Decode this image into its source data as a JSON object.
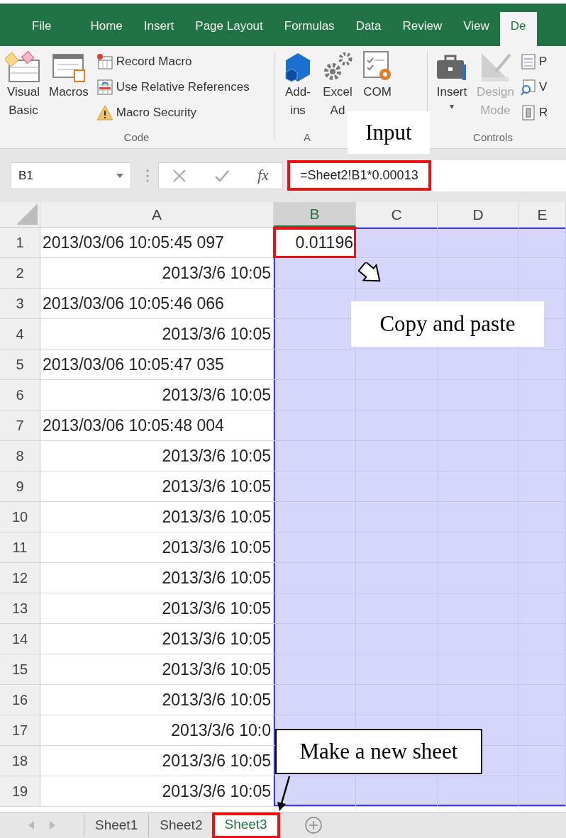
{
  "ribbon": {
    "tabs": [
      {
        "label": "File",
        "selected": false
      },
      {
        "label": "Home",
        "selected": false
      },
      {
        "label": "Insert",
        "selected": false
      },
      {
        "label": "Page Layout",
        "selected": false
      },
      {
        "label": "Formulas",
        "selected": false
      },
      {
        "label": "Data",
        "selected": false
      },
      {
        "label": "Review",
        "selected": false
      },
      {
        "label": "View",
        "selected": false
      },
      {
        "label": "De",
        "selected": true
      }
    ],
    "code_group": {
      "visual_basic": "Visual\nBasic",
      "macros": "Macros",
      "small_buttons": [
        "Record Macro",
        "Use Relative References",
        "Macro Security"
      ],
      "label": "Code"
    },
    "addins_group": {
      "add_ins": "Add-\nins",
      "excel_add_ins": "Excel\nAd",
      "com_add_ins": "COM",
      "label": "A"
    },
    "controls_group": {
      "insert": "Insert",
      "insert_caret": "▾",
      "design_mode": {
        "label": "Design\nMode",
        "disabled": true
      },
      "small_buttons": [
        "P",
        "V",
        "R"
      ],
      "label": "Controls"
    }
  },
  "formula_bar": {
    "name_box": "B1",
    "insert_function": "fx",
    "formula": "=Sheet2!B1*0.00013",
    "highlighted": true
  },
  "sheet": {
    "columns": [
      {
        "label": "A",
        "selected": false
      },
      {
        "label": "B",
        "selected": true
      },
      {
        "label": "C",
        "selected": false
      },
      {
        "label": "D",
        "selected": false
      },
      {
        "label": "E",
        "selected": false
      }
    ],
    "rows": [
      {
        "label": "1",
        "cells": [
          {
            "text": "2013/03/06 10:05:45 097",
            "kind": "text"
          },
          {
            "text": "0.01196",
            "kind": "number",
            "active": true,
            "highlighted": true,
            "in_range": true
          },
          {
            "in_range": true
          },
          {
            "in_range": true
          },
          {
            "in_range": true
          }
        ]
      },
      {
        "label": "2",
        "cells": [
          {
            "text": "2013/3/6 10:05",
            "kind": "date"
          },
          {
            "in_range": true
          },
          {
            "in_range": true
          },
          {
            "in_range": true
          },
          {
            "in_range": true
          }
        ]
      },
      {
        "label": "3",
        "cells": [
          {
            "text": "2013/03/06 10:05:46 066",
            "kind": "text"
          },
          {
            "in_range": true
          },
          {
            "in_range": true
          },
          {
            "in_range": true
          },
          {
            "in_range": true
          }
        ]
      },
      {
        "label": "4",
        "cells": [
          {
            "text": "2013/3/6 10:05",
            "kind": "date"
          },
          {
            "in_range": true
          },
          {
            "in_range": true
          },
          {
            "in_range": true
          },
          {
            "in_range": true
          }
        ]
      },
      {
        "label": "5",
        "cells": [
          {
            "text": "2013/03/06 10:05:47 035",
            "kind": "text"
          },
          {
            "in_range": true
          },
          {
            "in_range": true
          },
          {
            "in_range": true
          },
          {
            "in_range": true
          }
        ]
      },
      {
        "label": "6",
        "cells": [
          {
            "text": "2013/3/6 10:05",
            "kind": "date"
          },
          {
            "in_range": true
          },
          {
            "in_range": true
          },
          {
            "in_range": true
          },
          {
            "in_range": true
          }
        ]
      },
      {
        "label": "7",
        "cells": [
          {
            "text": "2013/03/06 10:05:48 004",
            "kind": "text"
          },
          {
            "in_range": true
          },
          {
            "in_range": true
          },
          {
            "in_range": true
          },
          {
            "in_range": true
          }
        ]
      },
      {
        "label": "8",
        "cells": [
          {
            "text": "2013/3/6 10:05",
            "kind": "date"
          },
          {
            "in_range": true
          },
          {
            "in_range": true
          },
          {
            "in_range": true
          },
          {
            "in_range": true
          }
        ]
      },
      {
        "label": "9",
        "cells": [
          {
            "text": "2013/3/6 10:05",
            "kind": "date"
          },
          {
            "in_range": true
          },
          {
            "in_range": true
          },
          {
            "in_range": true
          },
          {
            "in_range": true
          }
        ]
      },
      {
        "label": "10",
        "cells": [
          {
            "text": "2013/3/6 10:05",
            "kind": "date"
          },
          {
            "in_range": true
          },
          {
            "in_range": true
          },
          {
            "in_range": true
          },
          {
            "in_range": true
          }
        ]
      },
      {
        "label": "11",
        "cells": [
          {
            "text": "2013/3/6 10:05",
            "kind": "date"
          },
          {
            "in_range": true
          },
          {
            "in_range": true
          },
          {
            "in_range": true
          },
          {
            "in_range": true
          }
        ]
      },
      {
        "label": "12",
        "cells": [
          {
            "text": "2013/3/6 10:05",
            "kind": "date"
          },
          {
            "in_range": true
          },
          {
            "in_range": true
          },
          {
            "in_range": true
          },
          {
            "in_range": true
          }
        ]
      },
      {
        "label": "13",
        "cells": [
          {
            "text": "2013/3/6 10:05",
            "kind": "date"
          },
          {
            "in_range": true
          },
          {
            "in_range": true
          },
          {
            "in_range": true
          },
          {
            "in_range": true
          }
        ]
      },
      {
        "label": "14",
        "cells": [
          {
            "text": "2013/3/6 10:05",
            "kind": "date"
          },
          {
            "in_range": true
          },
          {
            "in_range": true
          },
          {
            "in_range": true
          },
          {
            "in_range": true
          }
        ]
      },
      {
        "label": "15",
        "cells": [
          {
            "text": "2013/3/6 10:05",
            "kind": "date"
          },
          {
            "in_range": true
          },
          {
            "in_range": true
          },
          {
            "in_range": true
          },
          {
            "in_range": true
          }
        ]
      },
      {
        "label": "16",
        "cells": [
          {
            "text": "2013/3/6 10:05",
            "kind": "date"
          },
          {
            "in_range": true
          },
          {
            "in_range": true
          },
          {
            "in_range": true
          },
          {
            "in_range": true
          }
        ]
      },
      {
        "label": "17",
        "cells": [
          {
            "text": "2013/3/6 10:0",
            "kind": "date"
          },
          {
            "in_range": true
          },
          {
            "in_range": true
          },
          {
            "in_range": true
          },
          {
            "in_range": true
          }
        ]
      },
      {
        "label": "18",
        "cells": [
          {
            "text": "2013/3/6 10:05",
            "kind": "date"
          },
          {
            "in_range": true
          },
          {
            "in_range": true
          },
          {
            "in_range": true
          },
          {
            "in_range": true
          }
        ]
      },
      {
        "label": "19",
        "cells": [
          {
            "text": "2013/3/6 10:05",
            "kind": "date"
          },
          {
            "in_range": true
          },
          {
            "in_range": true
          },
          {
            "in_range": true
          },
          {
            "in_range": true
          }
        ]
      }
    ]
  },
  "sheet_tabs": [
    {
      "label": "Sheet1",
      "selected": false,
      "highlighted": false
    },
    {
      "label": "Sheet2",
      "selected": false,
      "highlighted": false
    },
    {
      "label": "Sheet3",
      "selected": true,
      "highlighted": true
    }
  ],
  "callouts": [
    {
      "text": "Input",
      "bordered": false
    },
    {
      "text": "Copy and paste",
      "bordered": false
    },
    {
      "text": "Make a new sheet",
      "bordered": true
    }
  ]
}
